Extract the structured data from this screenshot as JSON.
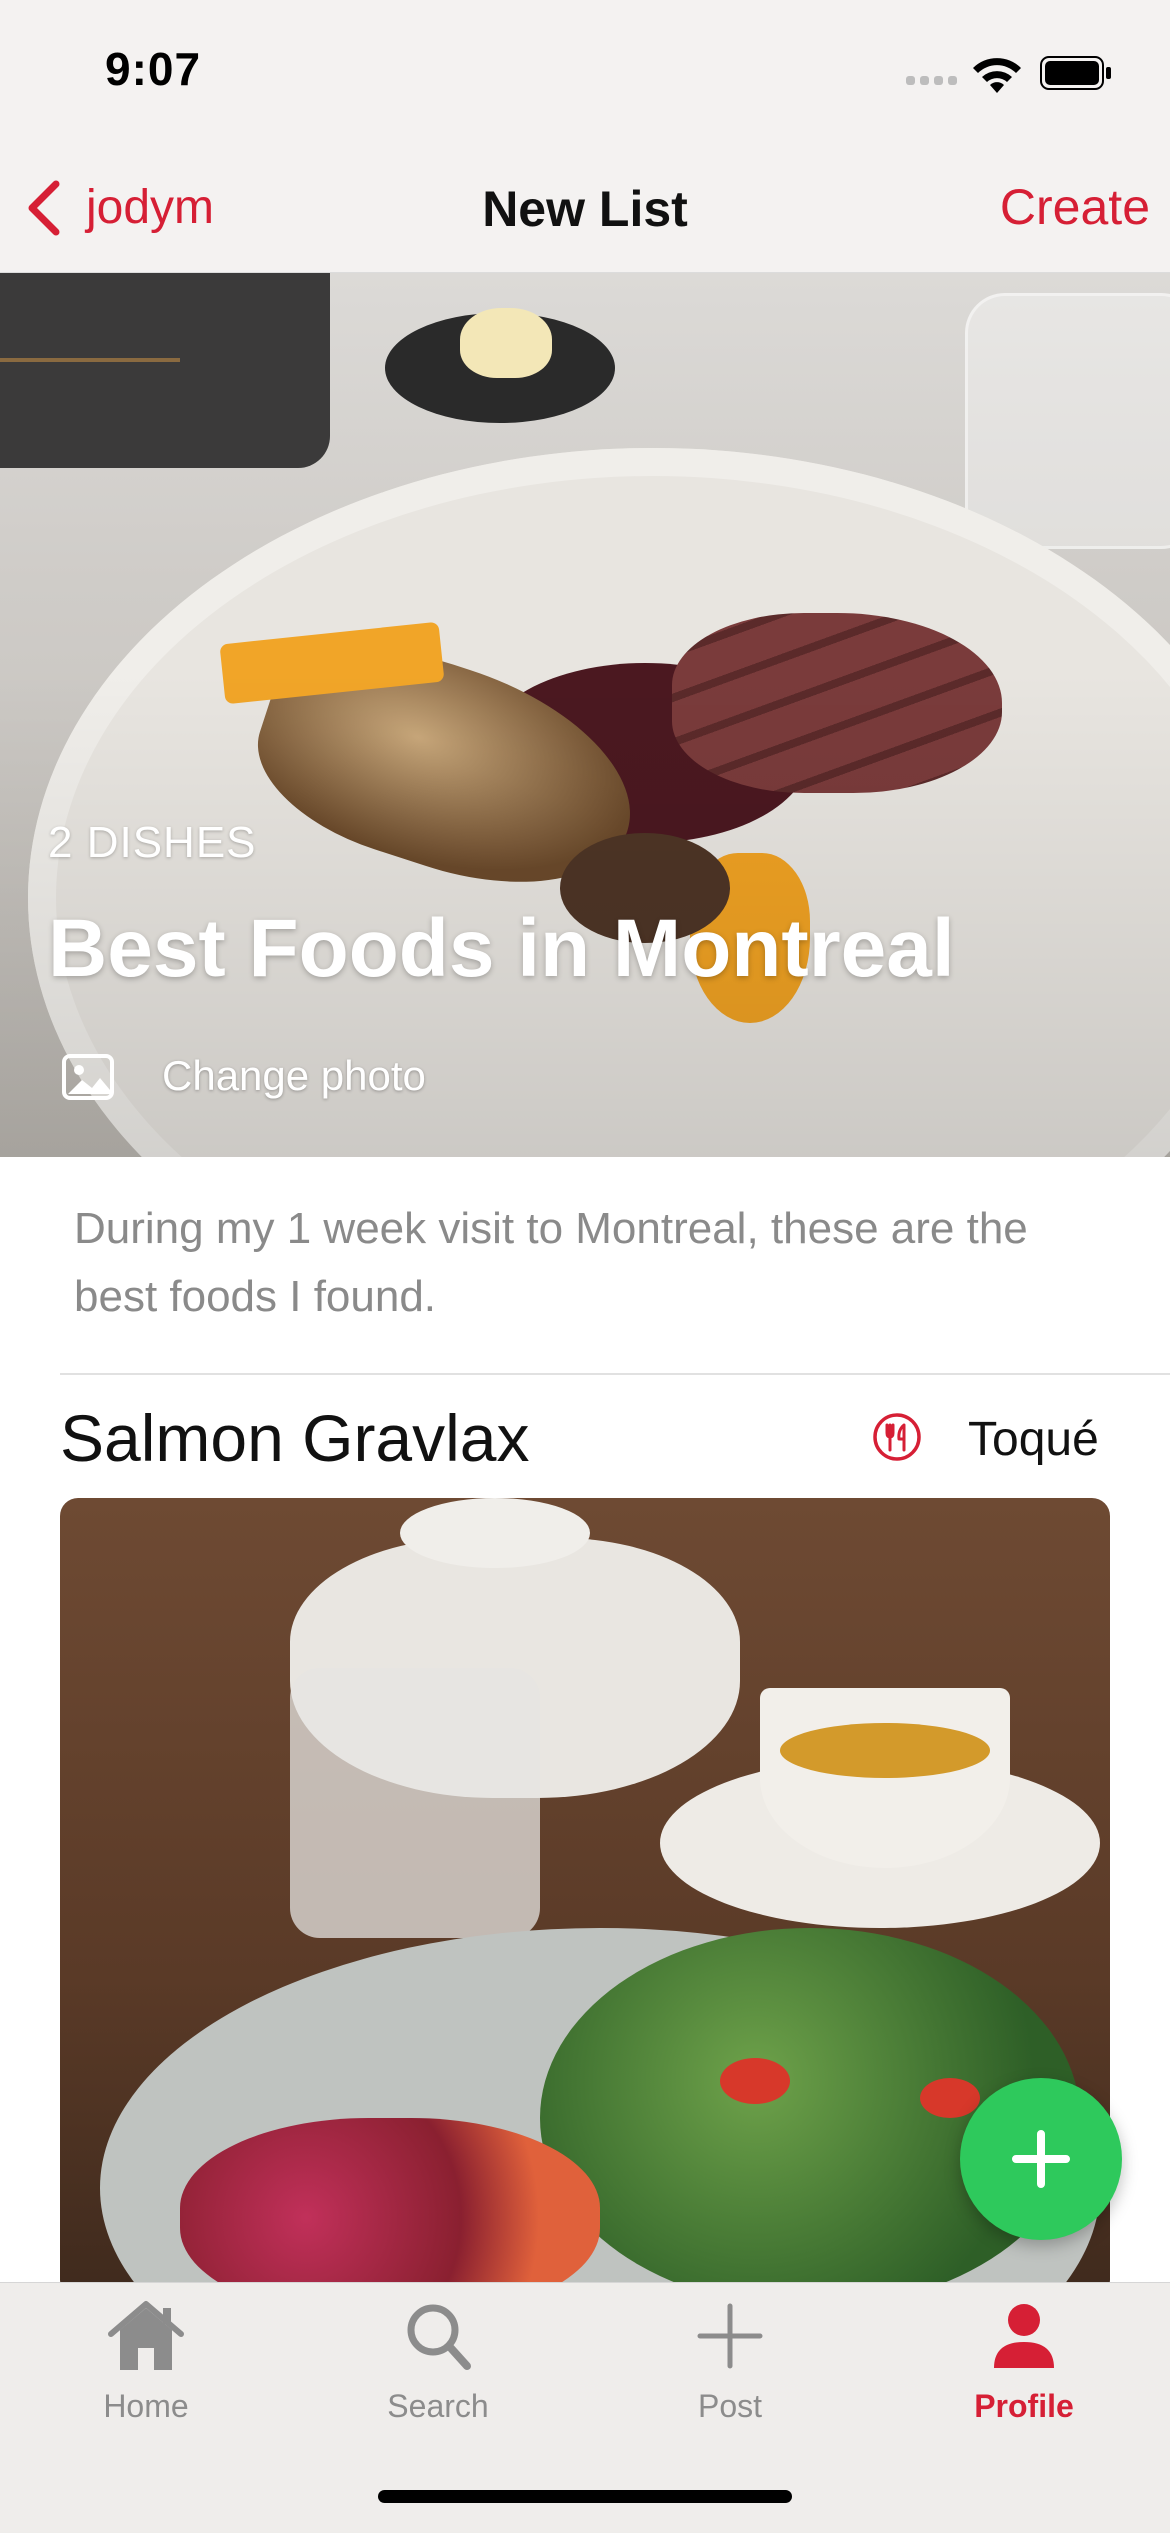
{
  "status_bar": {
    "time": "9:07"
  },
  "nav": {
    "back_label": "jodym",
    "title": "New List",
    "action_label": "Create"
  },
  "hero": {
    "dish_count": "2 DISHES",
    "title": "Best Foods in Montreal",
    "change_photo_label": "Change photo"
  },
  "description": "During my 1 week visit to Montreal, these are the best foods I found.",
  "dishes": [
    {
      "name": "Salmon Gravlax",
      "restaurant": "Toqué"
    }
  ],
  "tabs": [
    {
      "label": "Home",
      "icon": "home-icon"
    },
    {
      "label": "Search",
      "icon": "search-icon"
    },
    {
      "label": "Post",
      "icon": "plus-icon"
    },
    {
      "label": "Profile",
      "icon": "person-icon",
      "active": true
    }
  ],
  "colors": {
    "accent": "#d61f35",
    "fab": "#2ec95c",
    "inactive_tab": "#8c8c8c"
  }
}
